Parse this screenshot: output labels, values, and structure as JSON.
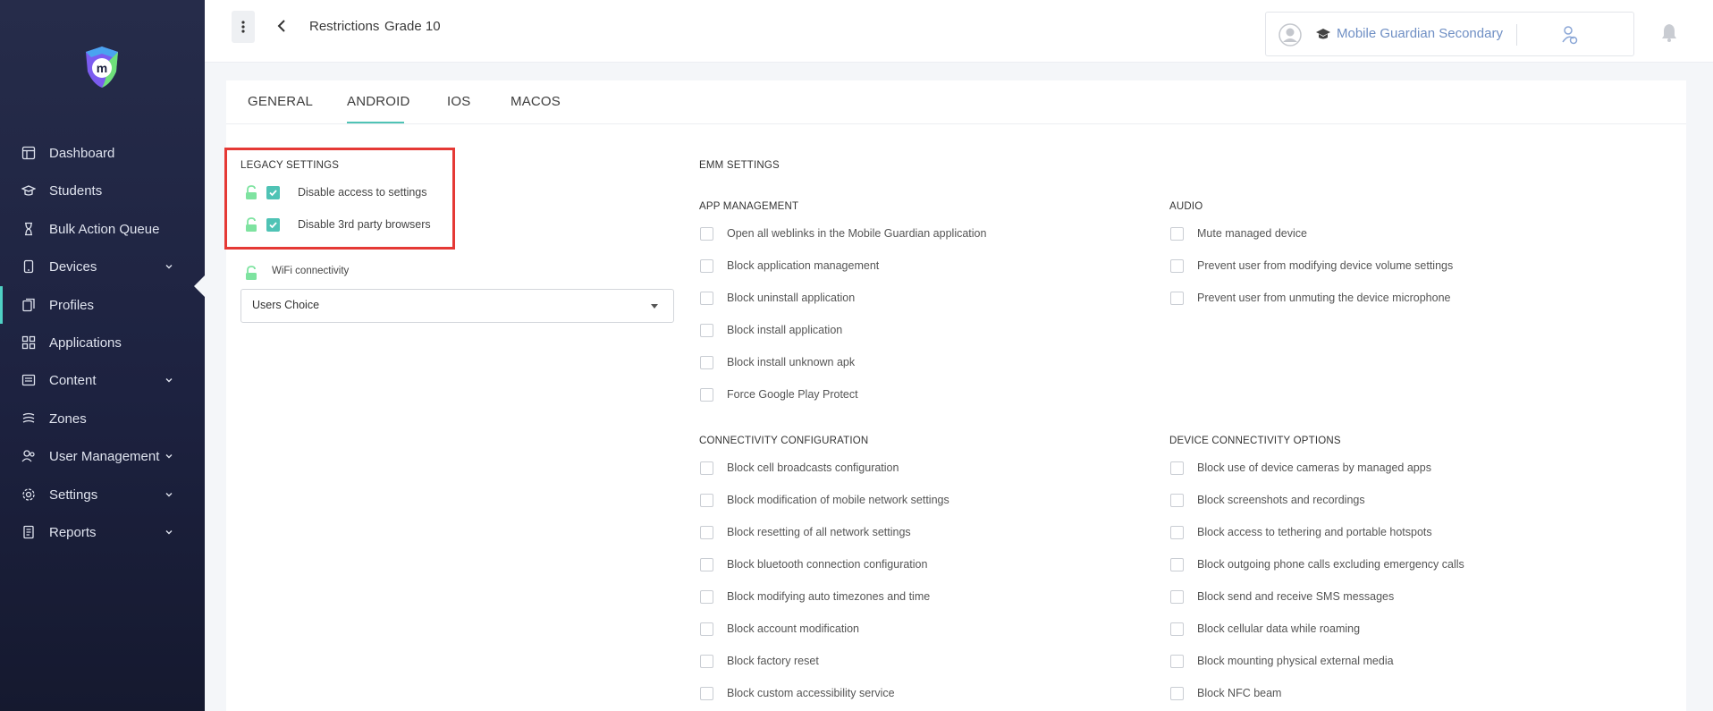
{
  "sidebar": {
    "items": [
      {
        "label": "Dashboard",
        "icon": "dashboard-icon",
        "expandable": false
      },
      {
        "label": "Students",
        "icon": "students-icon",
        "expandable": false
      },
      {
        "label": "Bulk Action Queue",
        "icon": "hourglass-icon",
        "expandable": false
      },
      {
        "label": "Devices",
        "icon": "device-icon",
        "expandable": true
      },
      {
        "label": "Profiles",
        "icon": "profiles-icon",
        "expandable": false,
        "active": true
      },
      {
        "label": "Applications",
        "icon": "grid-icon",
        "expandable": false
      },
      {
        "label": "Content",
        "icon": "content-icon",
        "expandable": true
      },
      {
        "label": "Zones",
        "icon": "zones-icon",
        "expandable": false
      },
      {
        "label": "User Management",
        "icon": "users-icon",
        "expandable": true
      },
      {
        "label": "Settings",
        "icon": "gear-icon",
        "expandable": true
      },
      {
        "label": "Reports",
        "icon": "reports-icon",
        "expandable": true
      }
    ]
  },
  "header": {
    "breadcrumb": [
      "Restrictions",
      "Grade 10"
    ],
    "school_name": "Mobile Guardian Secondary"
  },
  "tabs": [
    "GENERAL",
    "ANDROID",
    "IOS",
    "MACOS"
  ],
  "active_tab": "ANDROID",
  "legacy": {
    "title": "LEGACY SETTINGS",
    "items": [
      {
        "label": "Disable access to settings",
        "checked": true
      },
      {
        "label": "Disable 3rd party browsers",
        "checked": true
      }
    ],
    "wifi_label": "WiFi connectivity",
    "wifi_value": "Users Choice"
  },
  "emm": {
    "title": "EMM SETTINGS",
    "app_management": {
      "title": "APP MANAGEMENT",
      "items": [
        "Open all weblinks in the Mobile Guardian application",
        "Block application management",
        "Block uninstall application",
        "Block install application",
        "Block install unknown apk",
        "Force Google Play Protect"
      ]
    },
    "audio": {
      "title": "AUDIO",
      "items": [
        "Mute managed device",
        "Prevent user from modifying device volume settings",
        "Prevent user from unmuting the device microphone"
      ]
    },
    "connectivity": {
      "title": "CONNECTIVITY CONFIGURATION",
      "items": [
        "Block cell broadcasts configuration",
        "Block modification of mobile network settings",
        "Block resetting of all network settings",
        "Block bluetooth connection configuration",
        "Block modifying auto timezones and time",
        "Block account modification",
        "Block factory reset",
        "Block custom accessibility service"
      ]
    },
    "device_connectivity": {
      "title": "DEVICE CONNECTIVITY OPTIONS",
      "items": [
        "Block use of device cameras by managed apps",
        "Block screenshots and recordings",
        "Block access to tethering and portable hotspots",
        "Block outgoing phone calls excluding emergency calls",
        "Block send and receive SMS messages",
        "Block cellular data while roaming",
        "Block mounting physical external media",
        "Block NFC beam"
      ]
    }
  },
  "colors": {
    "sidebar_bg": "#1d2240",
    "accent": "#4fc3b5",
    "highlight_border": "#e53935",
    "lock_green": "#6fdc8c",
    "school_link": "#6f8fc4"
  }
}
